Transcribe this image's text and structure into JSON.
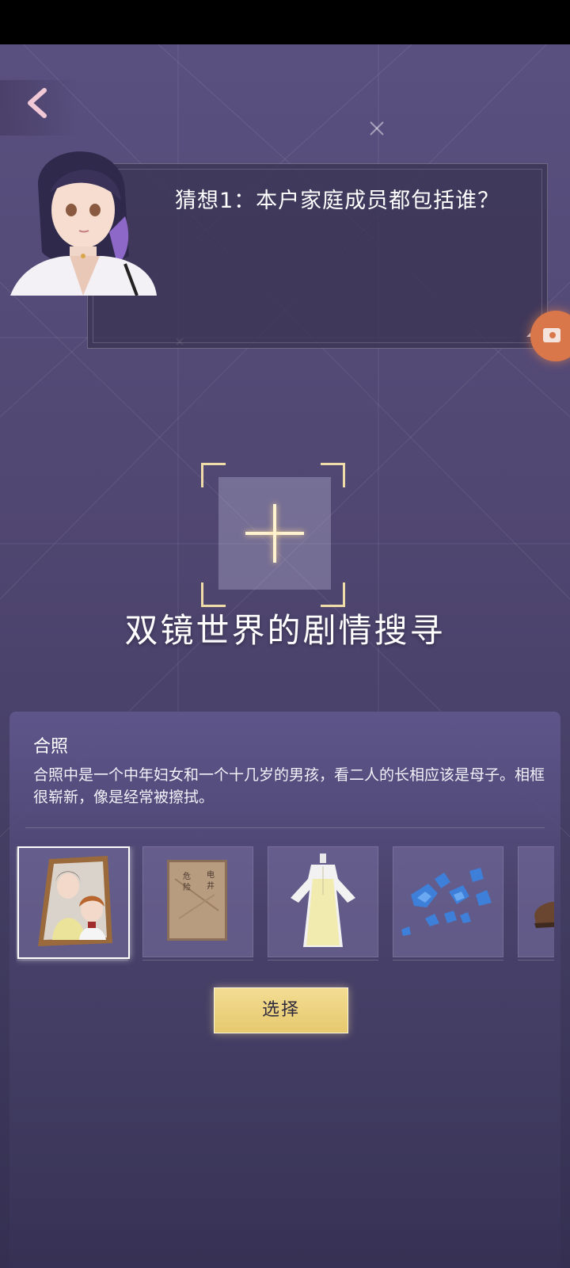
{
  "dialog": {
    "text": "猜想1：本户家庭成员都包括谁？"
  },
  "scan": {
    "title": "双镜世界的剧情搜寻"
  },
  "item": {
    "title": "合照",
    "description": "合照中是一个中年妇女和一个十几岁的男孩，看二人的长相应该是母子。相框很崭新，像是经常被擦拭。"
  },
  "slots": [
    {
      "name": "photo-frame",
      "selected": true
    },
    {
      "name": "book",
      "book_text": [
        "危",
        "险",
        "电",
        "井"
      ],
      "selected": false
    },
    {
      "name": "dress",
      "selected": false
    },
    {
      "name": "blue-fragments",
      "selected": false
    },
    {
      "name": "shoe",
      "selected": false
    }
  ],
  "select_button": {
    "label": "选择"
  },
  "colors": {
    "accent_gold": "#f0dca8",
    "button_gold": "#e6c86e",
    "record_orange": "#d9774b",
    "back_pink": "#f1c9d6"
  }
}
